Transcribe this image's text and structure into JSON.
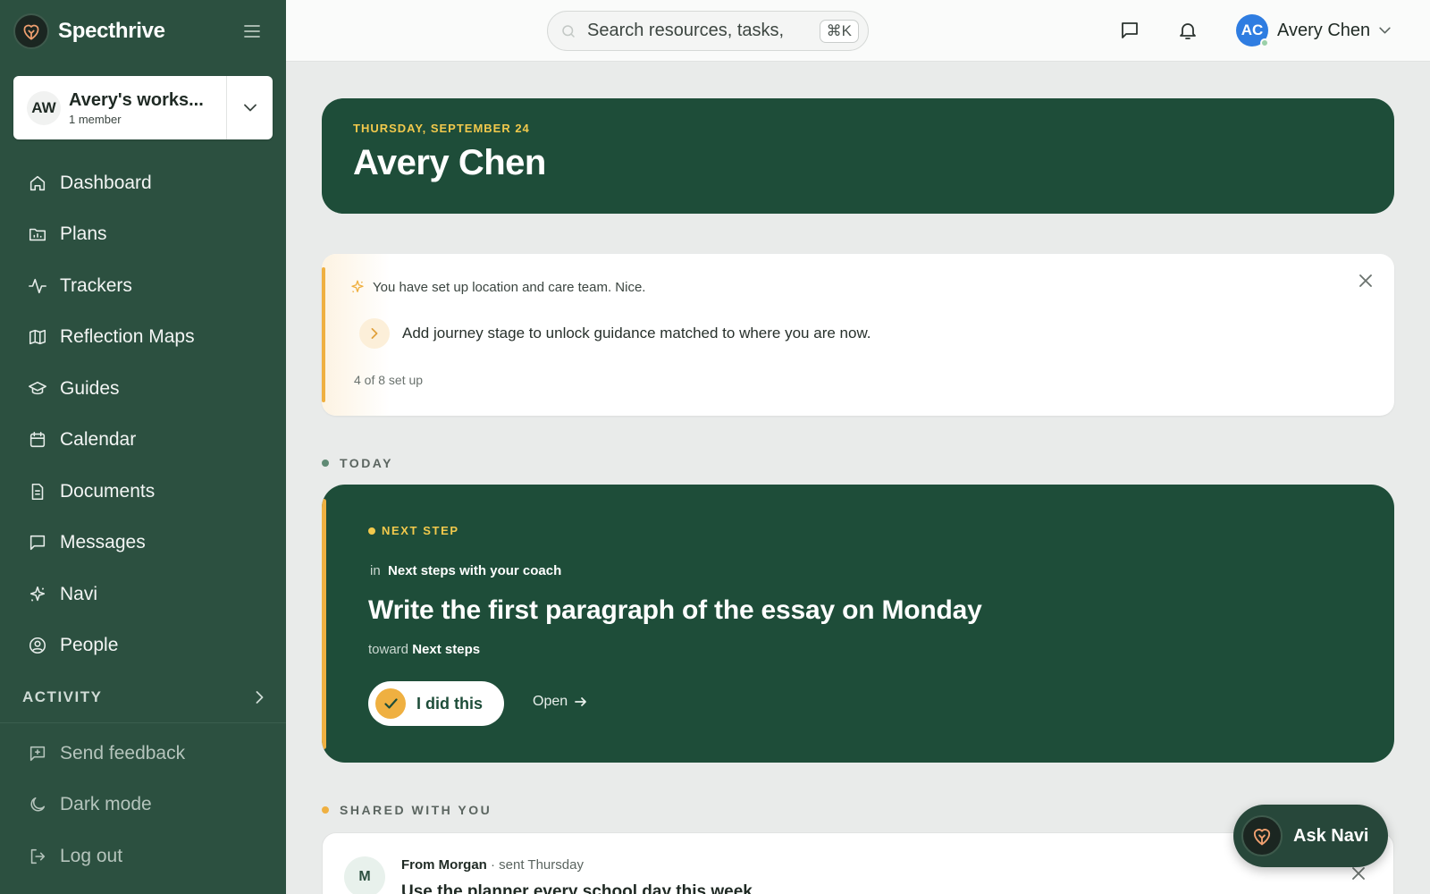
{
  "brand": {
    "name": "Specthrive"
  },
  "workspace": {
    "initials": "AW",
    "name": "Avery's works...",
    "members": "1 member"
  },
  "nav": [
    {
      "label": "Dashboard",
      "icon": "home-icon"
    },
    {
      "label": "Plans",
      "icon": "folder-chart-icon"
    },
    {
      "label": "Trackers",
      "icon": "activity-icon"
    },
    {
      "label": "Reflection Maps",
      "icon": "map-icon"
    },
    {
      "label": "Guides",
      "icon": "graduation-cap-icon"
    },
    {
      "label": "Calendar",
      "icon": "calendar-icon"
    },
    {
      "label": "Documents",
      "icon": "document-icon"
    },
    {
      "label": "Messages",
      "icon": "message-icon"
    },
    {
      "label": "Navi",
      "icon": "sparkle-icon"
    },
    {
      "label": "People",
      "icon": "user-circle-icon"
    }
  ],
  "activity": {
    "label": "ACTIVITY"
  },
  "footer_nav": [
    {
      "label": "Send feedback",
      "icon": "feedback-icon"
    },
    {
      "label": "Dark mode",
      "icon": "moon-icon"
    },
    {
      "label": "Log out",
      "icon": "logout-icon"
    }
  ],
  "topbar": {
    "search_placeholder": "Search resources, tasks,",
    "search_shortcut": "⌘K",
    "user": {
      "initials": "AC",
      "name": "Avery Chen"
    }
  },
  "hero": {
    "date": "THURSDAY, SEPTEMBER 24",
    "name": "Avery Chen"
  },
  "setup": {
    "message": "You have set up location and care team. Nice.",
    "next_action": "Add journey stage to unlock guidance matched to where you are now.",
    "progress": "4 of 8 set up"
  },
  "today": {
    "label": "TODAY",
    "badge": "NEXT STEP",
    "in_prefix": "in",
    "in_plan": "Next steps with your coach",
    "title": "Write the first paragraph of the essay on Monday",
    "toward_prefix": "toward",
    "toward_goal": "Next steps",
    "done_label": "I did this",
    "open_label": "Open"
  },
  "shared": {
    "label": "SHARED WITH YOU",
    "avatar": "M",
    "from": "From Morgan",
    "sent": "· sent Thursday",
    "title": "Use the planner every school day this week"
  },
  "ask_navi": {
    "label": "Ask Navi"
  },
  "colors": {
    "sidebar": "#2c5040",
    "hero": "#1e4d39",
    "accent": "#efb041",
    "user_avatar": "#2f7de1"
  }
}
